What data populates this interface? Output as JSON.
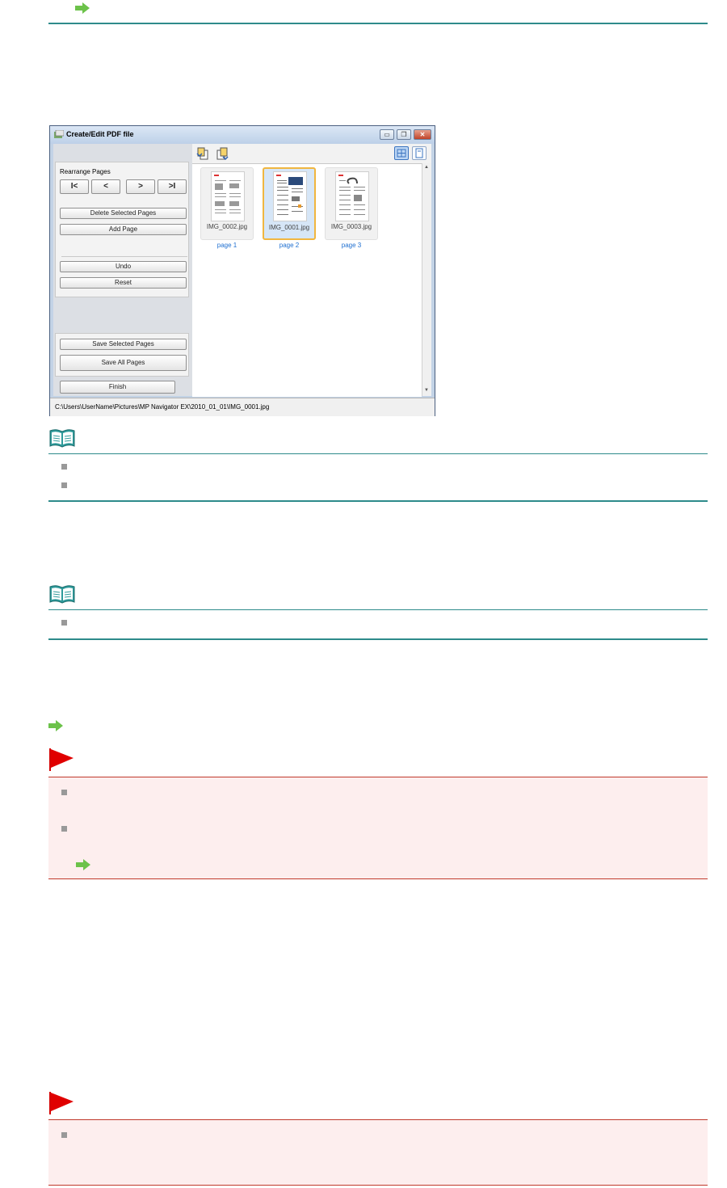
{
  "window": {
    "title": "Create/Edit PDF file",
    "minimize_glyph": "▭",
    "restore_glyph": "❐",
    "close_glyph": "✕",
    "rearrange_label": "Rearrange Pages",
    "nav": {
      "first": "I<",
      "prev": "<",
      "next": ">",
      "last": ">I"
    },
    "delete_label": "Delete Selected Pages",
    "add_label": "Add Page",
    "undo_label": "Undo",
    "reset_label": "Reset",
    "save_selected_label": "Save Selected Pages",
    "save_all_label": "Save All Pages",
    "finish_label": "Finish",
    "thumbnails": [
      {
        "filename": "IMG_0002.jpg",
        "page": "page 1",
        "selected": false
      },
      {
        "filename": "IMG_0001.jpg",
        "page": "page 2",
        "selected": true
      },
      {
        "filename": "IMG_0003.jpg",
        "page": "page 3",
        "selected": false
      }
    ],
    "status_path": "C:\\Users\\UserName\\Pictures\\MP Navigator EX\\2010_01_01\\IMG_0001.jpg",
    "scroll_up_glyph": "▲",
    "scroll_down_glyph": "▼"
  },
  "colors": {
    "teal_rule": "#2e8b8b",
    "caution_red": "#c0392b",
    "caution_bg": "#fdeeee",
    "link_arrow": "#6cc24a",
    "page_link": "#1e6fd0"
  },
  "icons": [
    "arrow-icon",
    "note-icon",
    "caution-flag-icon",
    "bullet-icon"
  ]
}
